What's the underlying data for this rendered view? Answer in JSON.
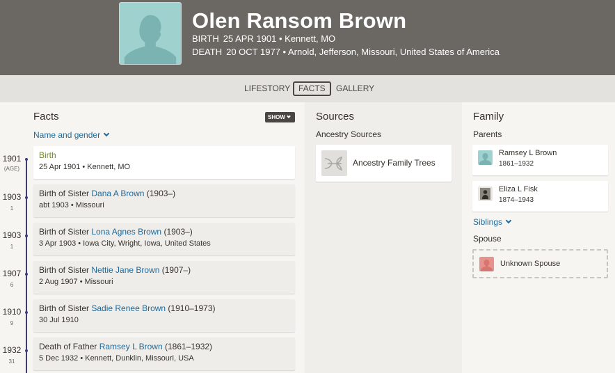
{
  "header": {
    "name": "Olen Ransom Brown",
    "birth_label": "BIRTH",
    "birth_value": "25 APR 1901 • Kennett, MO",
    "death_label": "DEATH",
    "death_value": "20 OCT 1977 • Arnold, Jefferson, Missouri, United States of America"
  },
  "tabs": [
    {
      "label": "LIFESTORY",
      "active": false
    },
    {
      "label": "FACTS",
      "active": true
    },
    {
      "label": "GALLERY",
      "active": false
    }
  ],
  "facts": {
    "title": "Facts",
    "show_label": "SHOW",
    "name_gender_label": "Name and gender",
    "items": [
      {
        "year": "1901",
        "age": "(AGE)",
        "prefix": "",
        "type_label": "Birth",
        "person": "",
        "dates": "",
        "detail": "25 Apr 1901 • Kennett, MO"
      },
      {
        "year": "1903",
        "age": "1",
        "prefix": "Birth of Sister ",
        "type_label": "",
        "person": "Dana A Brown",
        "dates": " (1903–)",
        "detail": "abt 1903 • Missouri"
      },
      {
        "year": "1903",
        "age": "1",
        "prefix": "Birth of Sister ",
        "type_label": "",
        "person": "Lona Agnes Brown",
        "dates": " (1903–)",
        "detail": "3 Apr 1903 • Iowa City, Wright, Iowa, United States"
      },
      {
        "year": "1907",
        "age": "6",
        "prefix": "Birth of Sister ",
        "type_label": "",
        "person": "Nettie Jane Brown",
        "dates": " (1907–)",
        "detail": "2 Aug 1907 • Missouri"
      },
      {
        "year": "1910",
        "age": "9",
        "prefix": "Birth of Sister ",
        "type_label": "",
        "person": "Sadie Renee Brown",
        "dates": " (1910–1973)",
        "detail": "30 Jul 1910"
      },
      {
        "year": "1932",
        "age": "31",
        "prefix": "Death of Father ",
        "type_label": "",
        "person": "Ramsey L Brown",
        "dates": " (1861–1932)",
        "detail": "5 Dec 1932 • Kennett, Dunklin, Missouri, USA"
      }
    ]
  },
  "sources": {
    "title": "Sources",
    "subtitle": "Ancestry Sources",
    "card_label": "Ancestry Family Trees"
  },
  "family": {
    "title": "Family",
    "parents_label": "Parents",
    "parents": [
      {
        "name": "Ramsey L Brown",
        "dates": "1861–1932"
      },
      {
        "name": "Eliza L Fisk",
        "dates": "1874–1943"
      }
    ],
    "siblings_label": "Siblings",
    "spouse_label": "Spouse",
    "spouse_name": "Unknown Spouse"
  },
  "colors": {
    "header_bg": "#6b6762",
    "link": "#1f6a9a",
    "birth_green": "#6f8c1b",
    "timeline": "#3d3a80",
    "male_avatar": "#9fd1cf",
    "female_avatar": "#e8928d"
  },
  "icons": {
    "person_avatar": "male-silhouette-icon",
    "source": "leaf-icon",
    "show_chevron": "chevron-down-icon"
  }
}
